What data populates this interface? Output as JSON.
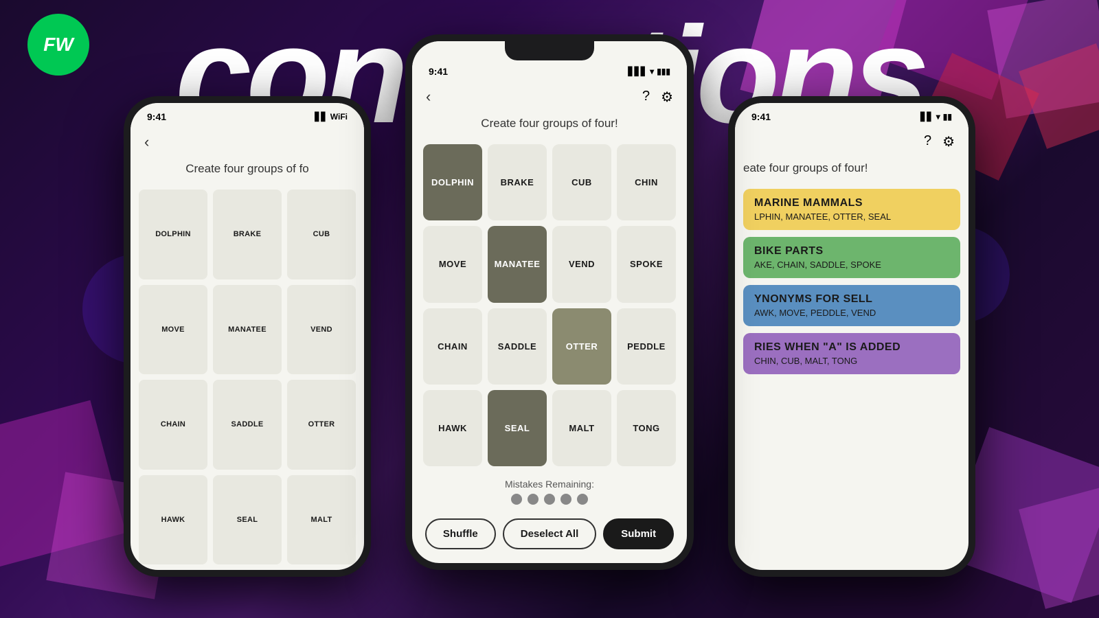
{
  "background": {
    "title": "Connections"
  },
  "fw_logo": {
    "text": "FW"
  },
  "center_phone": {
    "status_time": "9:41",
    "subtitle": "Create four groups of four!",
    "grid": [
      {
        "word": "DOLPHIN",
        "state": "selected-dark"
      },
      {
        "word": "BRAKE",
        "state": "normal"
      },
      {
        "word": "CUB",
        "state": "normal"
      },
      {
        "word": "CHIN",
        "state": "normal"
      },
      {
        "word": "MOVE",
        "state": "normal"
      },
      {
        "word": "MANATEE",
        "state": "selected-dark"
      },
      {
        "word": "VEND",
        "state": "normal"
      },
      {
        "word": "SPOKE",
        "state": "normal"
      },
      {
        "word": "CHAIN",
        "state": "normal"
      },
      {
        "word": "SADDLE",
        "state": "normal"
      },
      {
        "word": "OTTER",
        "state": "selected-medium"
      },
      {
        "word": "PEDDLE",
        "state": "normal"
      },
      {
        "word": "HAWK",
        "state": "normal"
      },
      {
        "word": "SEAL",
        "state": "selected-dark"
      },
      {
        "word": "MALT",
        "state": "normal"
      },
      {
        "word": "TONG",
        "state": "normal"
      }
    ],
    "mistakes_label": "Mistakes Remaining:",
    "dots": 5,
    "buttons": {
      "shuffle": "Shuffle",
      "deselect": "Deselect All",
      "submit": "Submit"
    }
  },
  "left_phone": {
    "status_time": "9:41",
    "subtitle": "Create four groups of fo",
    "grid": [
      {
        "word": "DOLPHIN"
      },
      {
        "word": "BRAKE"
      },
      {
        "word": "CUB"
      },
      {
        "word": "MOVE"
      },
      {
        "word": "MANATEE"
      },
      {
        "word": "VEND"
      },
      {
        "word": "CHAIN"
      },
      {
        "word": "SADDLE"
      },
      {
        "word": "OTTER"
      },
      {
        "word": "HAWK"
      },
      {
        "word": "SEAL"
      },
      {
        "word": "MALT"
      }
    ]
  },
  "right_phone": {
    "status_time": "9:41",
    "subtitle": "eate four groups of four!",
    "results": [
      {
        "type": "yellow",
        "title": "MARINE MAMMALS",
        "words": "LPHIN, MANATEE, OTTER, SEAL"
      },
      {
        "type": "green",
        "title": "BIKE PARTS",
        "words": "AKE, CHAIN, SADDLE, SPOKE"
      },
      {
        "type": "blue",
        "title": "YNONYMS FOR SELL",
        "words": "AWK, MOVE, PEDDLE, VEND"
      },
      {
        "type": "purple",
        "title": "RIES WHEN \"A\" IS ADDED",
        "words": "CHIN, CUB, MALT, TONG"
      }
    ]
  }
}
